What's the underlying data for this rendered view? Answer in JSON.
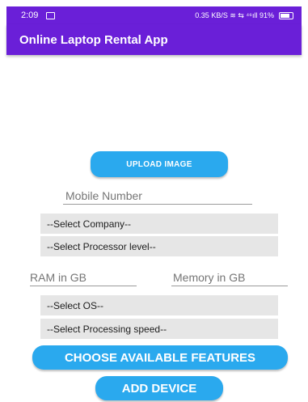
{
  "status_bar": {
    "time": "2:09",
    "indicators": "0.35 KB/S ≋ ⇆ ⁴⁶ıll 91%"
  },
  "app_bar": {
    "title": "Online Laptop Rental App"
  },
  "form": {
    "upload_image_label": "UPLOAD IMAGE",
    "mobile_number_placeholder": "Mobile Number",
    "select_company": "--Select Company--",
    "select_processor_level": "--Select Processor level--",
    "ram_placeholder": "RAM in GB",
    "memory_placeholder": "Memory in GB",
    "select_os": "--Select OS--",
    "select_processing_speed": "--Select Processing speed--",
    "choose_features_label": "CHOOSE AVAILABLE FEATURES",
    "add_device_label": "ADD DEVICE"
  },
  "colors": {
    "primary": "#6a1fd8",
    "button": "#2aa9ee",
    "spinner_background": "#e6e6e6"
  }
}
